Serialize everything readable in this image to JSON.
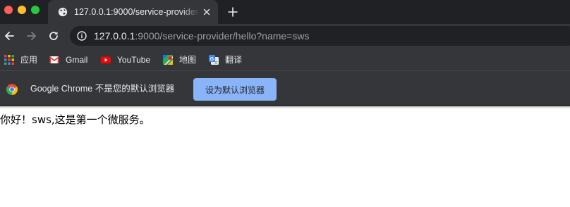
{
  "colors": {
    "tabstrip_bg": "#202124",
    "toolbar_bg": "#35363a",
    "infobar_button_bg": "#8ab4f8"
  },
  "window_controls": {
    "close": "red-dot",
    "minimize": "yellow-dot",
    "zoom": "green-dot"
  },
  "tab": {
    "title": "127.0.0.1:9000/service-provider/hello?name=sws",
    "favicon": "globe-icon",
    "close_icon": "close-icon"
  },
  "new_tab_icon": "plus-icon",
  "toolbar": {
    "back_icon": "arrow-left-icon",
    "forward_icon": "arrow-right-icon",
    "reload_icon": "reload-icon",
    "url_host": "127.0.0.1",
    "url_rest": ":9000/service-provider/hello?name=sws",
    "info_icon": "info-icon"
  },
  "bookmarks": {
    "apps": "应用",
    "gmail": "Gmail",
    "youtube": "YouTube",
    "maps": "地图",
    "translate": "翻译"
  },
  "infobar": {
    "message": "Google Chrome 不是您的默认浏览器",
    "button": "设为默认浏览器"
  },
  "page": {
    "content": "你好！sws,这是第一个微服务。"
  }
}
